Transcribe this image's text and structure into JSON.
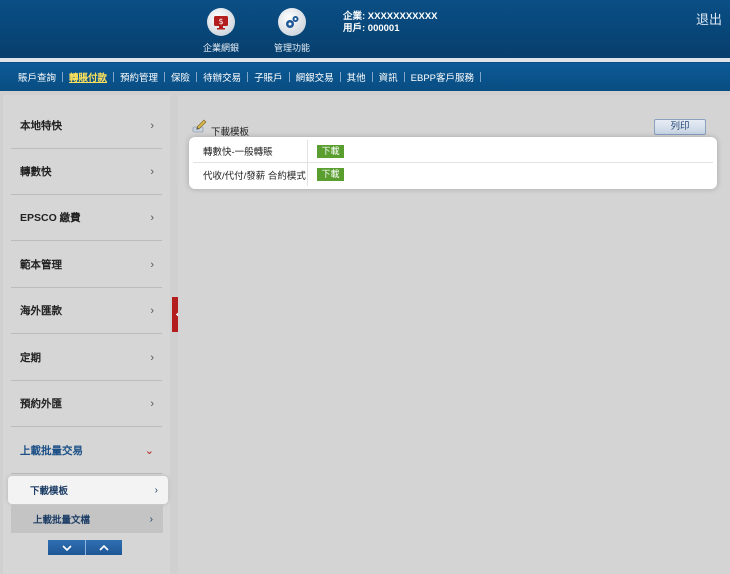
{
  "header": {
    "icons": [
      {
        "label": "企業網銀",
        "icon": "monitor-icon"
      },
      {
        "label": "管理功能",
        "icon": "gears-icon"
      }
    ],
    "company_line": "企業: XXXXXXXXXXX",
    "user_line": "用戶: 000001",
    "logout": "退出"
  },
  "nav": {
    "items": [
      "賬戶查詢",
      "轉賬付款",
      "預約管理",
      "保險",
      "待辦交易",
      "子賬戶",
      "網銀交易",
      "其他",
      "資訊",
      "EBPP客戶服務"
    ],
    "active_index": 1
  },
  "sidebar": {
    "items": [
      {
        "label": "本地特快",
        "chevron": "›"
      },
      {
        "label": "轉數快",
        "chevron": "›"
      },
      {
        "label": "EPSCO 繳費",
        "chevron": "›"
      },
      {
        "label": "範本管理",
        "chevron": "›"
      },
      {
        "label": "海外匯款",
        "chevron": "›"
      },
      {
        "label": "定期",
        "chevron": "›"
      },
      {
        "label": "預約外匯",
        "chevron": "›"
      },
      {
        "label": "上載批量交易",
        "chevron": "⌄"
      }
    ],
    "subitems": [
      {
        "label": "下載模板",
        "chevron": "›"
      },
      {
        "label": "上載批量文檔",
        "chevron": "›"
      }
    ]
  },
  "main": {
    "title": "下載模板",
    "print_label": "列印",
    "rows": [
      {
        "label": "轉數快-一般轉賬",
        "button": "下載"
      },
      {
        "label": "代收/代付/發薪 合約模式",
        "button": "下載"
      }
    ]
  },
  "colors": {
    "header_blue": "#0a4f86",
    "active_nav": "#ffe25a",
    "download_green": "#5a9e30",
    "collapse_red": "#b31d1d"
  }
}
